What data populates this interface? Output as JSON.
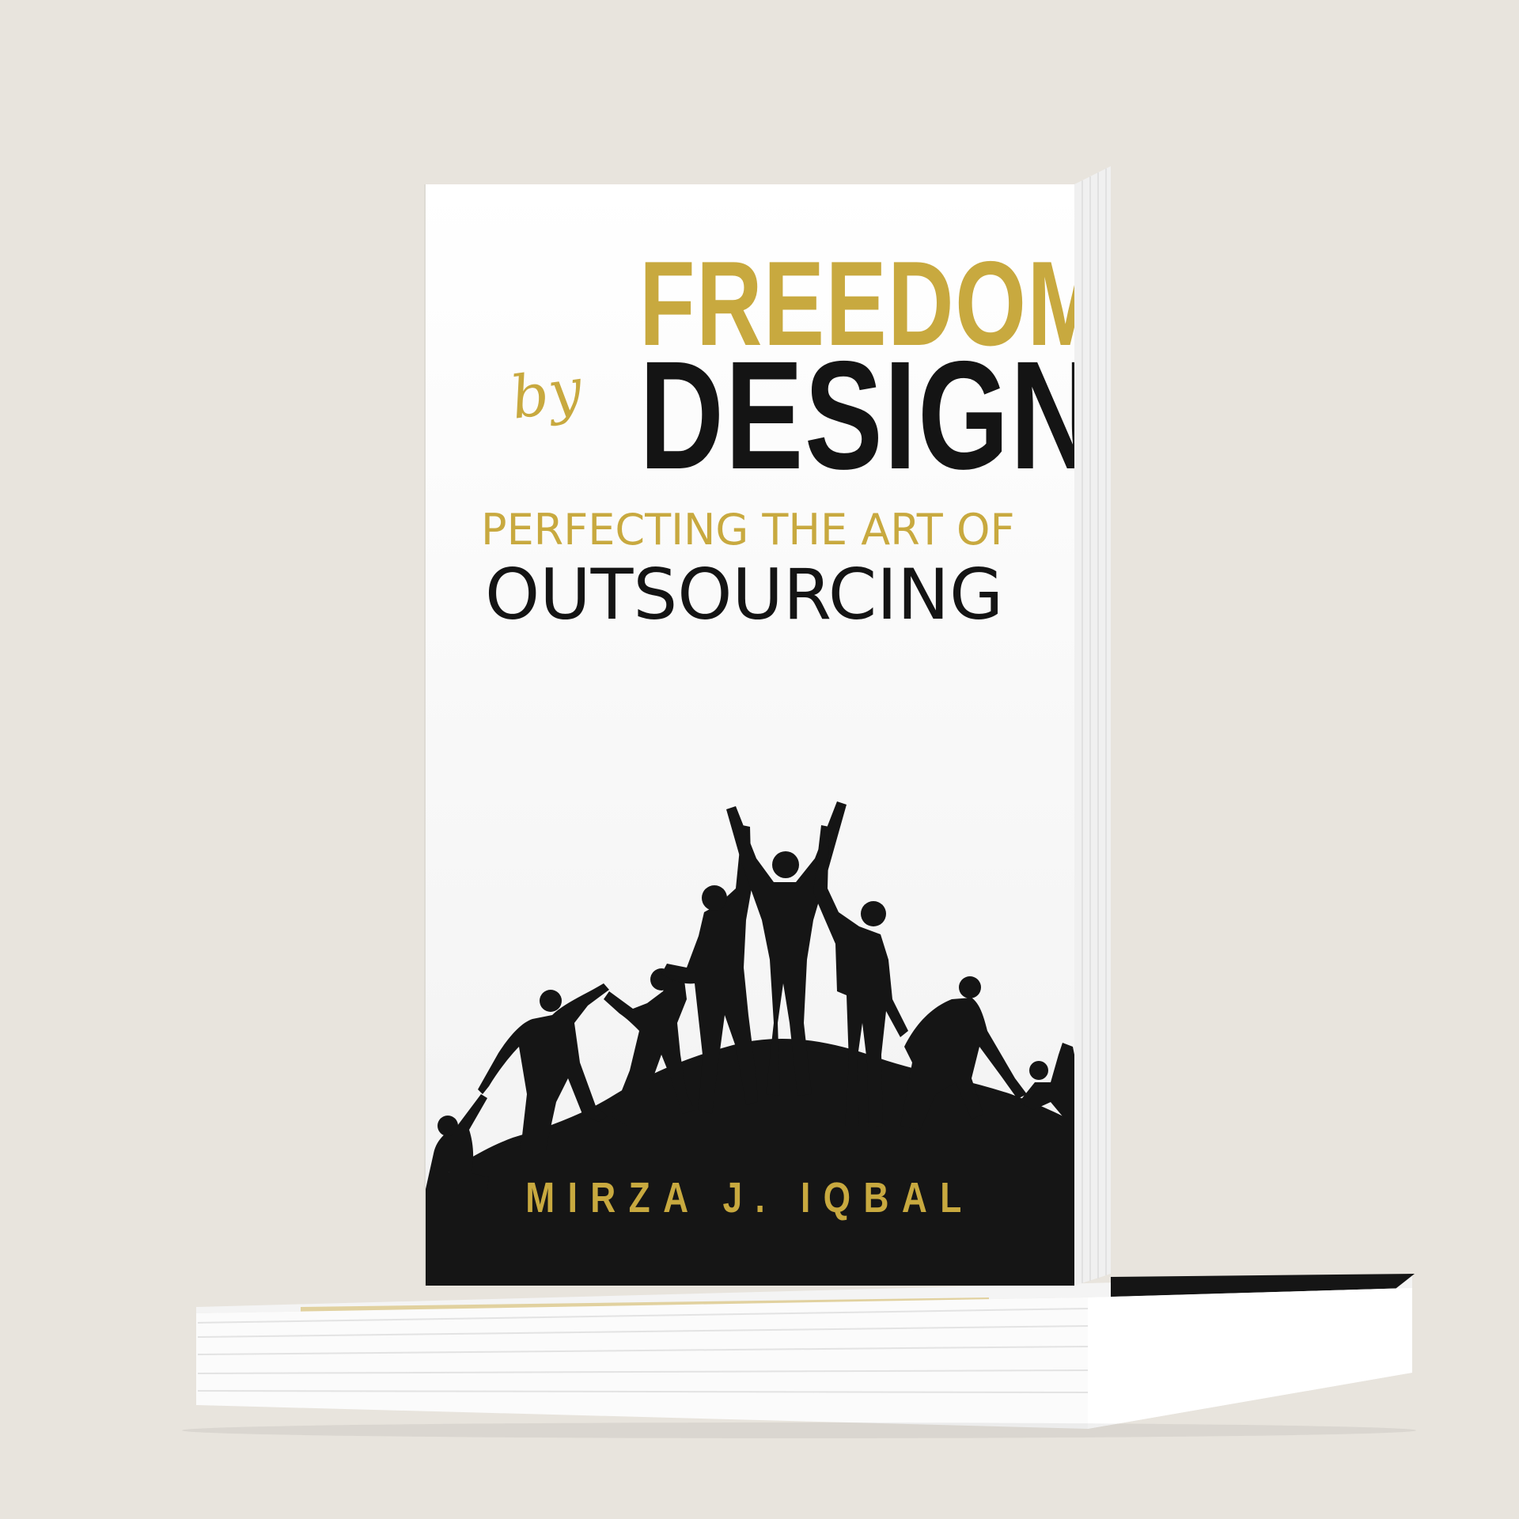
{
  "book": {
    "title_line1": "FREEDOM",
    "title_connector": "by",
    "title_line2": "DESIGN",
    "subtitle_line1": "PERFECTING THE ART OF",
    "subtitle_line2": "OUTSOURCING",
    "author": "MIRZA J. IQBAL"
  },
  "colors": {
    "background": "#e8e4dd",
    "gold": "#c8a93f",
    "black": "#141414",
    "cover_white": "#f7f7f7"
  }
}
